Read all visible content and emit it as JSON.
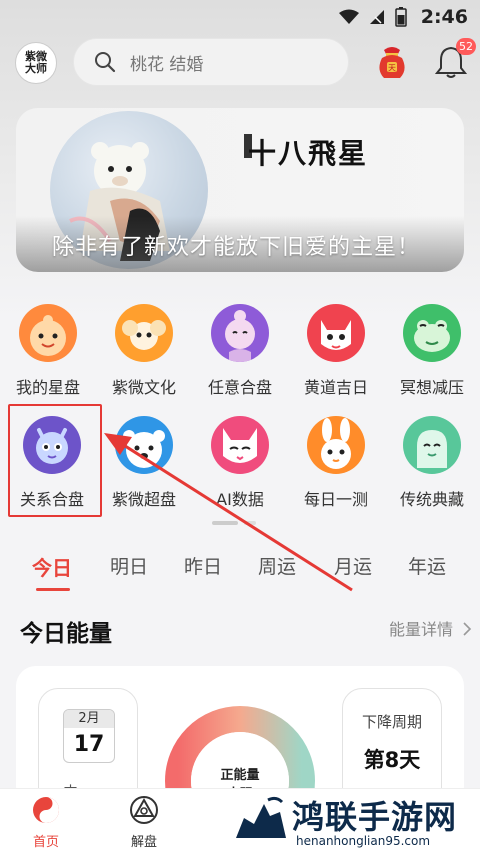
{
  "status_bar": {
    "time": "2:46"
  },
  "header": {
    "logo_text": "紫微\n大师",
    "search_placeholder": "桃花 结婚",
    "lucky_bag_text": "天",
    "notification_count": "52"
  },
  "banner": {
    "brand": "十八飛星",
    "slogan": "除非有了新欢才能放下旧爱的主星！"
  },
  "grid": {
    "row1": [
      {
        "label": "我的星盘",
        "icon": "orange-monk-icon",
        "color": "#ff8a3d"
      },
      {
        "label": "紫微文化",
        "icon": "ram-icon",
        "color": "#ff9f2e"
      },
      {
        "label": "任意合盘",
        "icon": "buddha-icon",
        "color": "#8e5bd8"
      },
      {
        "label": "黄道吉日",
        "icon": "red-beast-icon",
        "color": "#f0434f"
      },
      {
        "label": "冥想减压",
        "icon": "green-frog-icon",
        "color": "#3fbf6a"
      }
    ],
    "row2": [
      {
        "label": "关系合盘",
        "icon": "dragon-icon",
        "color": "#6d54c9"
      },
      {
        "label": "紫微超盘",
        "icon": "polar-bear-icon",
        "color": "#2f96e6"
      },
      {
        "label": "AI数据",
        "icon": "cat-icon",
        "color": "#f04c7d"
      },
      {
        "label": "每日一测",
        "icon": "rabbit-icon",
        "color": "#ff8c2a"
      },
      {
        "label": "传统典藏",
        "icon": "green-ghost-icon",
        "color": "#58c79a"
      }
    ]
  },
  "tabs": [
    "今日",
    "明日",
    "昨日",
    "周运",
    "月运",
    "年运"
  ],
  "energy": {
    "title": "今日能量",
    "more": "能量详情",
    "month": "2月",
    "day": "17",
    "date_sub": "内 周",
    "gauge_label": "正能量",
    "gauge_label2": "中强",
    "cycle_title": "下降周期",
    "cycle_value": "第8天"
  },
  "bottom_nav": [
    {
      "label": "首页",
      "icon": "home-taiji-icon",
      "active": true
    },
    {
      "label": "解盘",
      "icon": "chart-triangle-icon",
      "active": false
    }
  ],
  "watermark": {
    "title": "鸿联手游网",
    "url": "henanhonglian95.com"
  },
  "colors": {
    "accent": "#e8453c",
    "highlight_box": "#e53935"
  }
}
